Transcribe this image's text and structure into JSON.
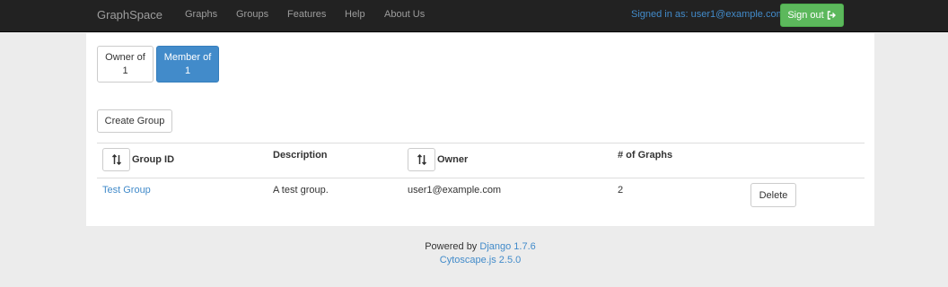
{
  "navbar": {
    "brand": "GraphSpace",
    "links": [
      "Graphs",
      "Groups",
      "Features",
      "Help",
      "About Us"
    ],
    "signed_in": "Signed in as: user1@example.com",
    "signout_label": "Sign out"
  },
  "tabs": {
    "owner_label": "Owner of",
    "owner_count": "1",
    "member_label": "Member of",
    "member_count": "1"
  },
  "create_group_label": "Create Group",
  "table": {
    "headers": [
      "Group ID",
      "Description",
      "Owner",
      "# of Graphs"
    ],
    "rows": [
      {
        "group_id": "Test Group",
        "description": "A test group.",
        "owner": "user1@example.com",
        "graphs": "2",
        "action": "Delete"
      }
    ]
  },
  "footer": {
    "powered_by": "Powered by",
    "django": "Django 1.7.6",
    "cytoscape": "Cytoscape.js 2.5.0"
  },
  "colors": {
    "navbar_bg": "#222222",
    "link": "#428bca",
    "success": "#5cb85c",
    "active_pill": "#428bca"
  }
}
